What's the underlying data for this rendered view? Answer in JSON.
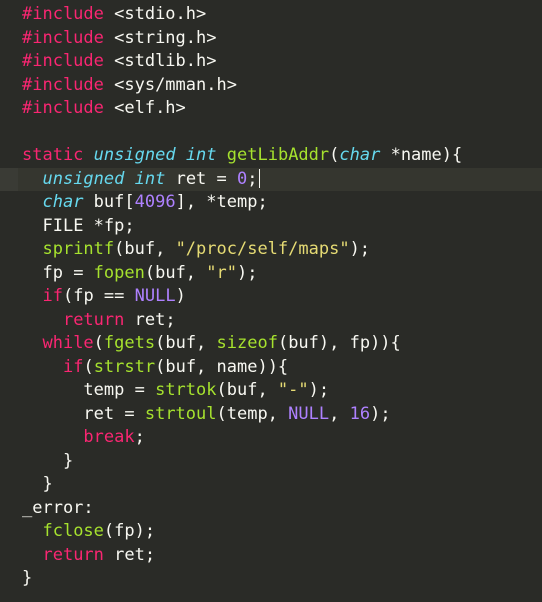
{
  "colors": {
    "background": "#2a2b27",
    "default": "#f8f8f2",
    "keyword": "#f92672",
    "type": "#66d9ef",
    "function": "#a6e22e",
    "string": "#e6db74",
    "number": "#ae81ff",
    "constant": "#ae81ff",
    "punct": "#f8f8f2"
  },
  "lines": [
    {
      "indent": 0,
      "tokens": [
        [
          "keyword",
          "#include"
        ],
        [
          "punct",
          " <stdio.h>"
        ]
      ]
    },
    {
      "indent": 0,
      "tokens": [
        [
          "keyword",
          "#include"
        ],
        [
          "punct",
          " <string.h>"
        ]
      ]
    },
    {
      "indent": 0,
      "tokens": [
        [
          "keyword",
          "#include"
        ],
        [
          "punct",
          " <stdlib.h>"
        ]
      ]
    },
    {
      "indent": 0,
      "tokens": [
        [
          "keyword",
          "#include"
        ],
        [
          "punct",
          " <sys/mman.h>"
        ]
      ]
    },
    {
      "indent": 0,
      "tokens": [
        [
          "keyword",
          "#include"
        ],
        [
          "punct",
          " <elf.h>"
        ]
      ]
    },
    {
      "indent": 0,
      "tokens": []
    },
    {
      "indent": 0,
      "tokens": [
        [
          "keyword",
          "static"
        ],
        [
          "punct",
          " "
        ],
        [
          "type",
          "unsigned"
        ],
        [
          "punct",
          " "
        ],
        [
          "type",
          "int"
        ],
        [
          "punct",
          " "
        ],
        [
          "function",
          "getLibAddr"
        ],
        [
          "punct",
          "("
        ],
        [
          "type",
          "char"
        ],
        [
          "punct",
          " *name){"
        ]
      ]
    },
    {
      "indent": 1,
      "current": true,
      "tokens": [
        [
          "type",
          "unsigned"
        ],
        [
          "punct",
          " "
        ],
        [
          "type",
          "int"
        ],
        [
          "punct",
          " ret = "
        ],
        [
          "number",
          "0"
        ],
        [
          "punct",
          ";"
        ]
      ]
    },
    {
      "indent": 1,
      "tokens": [
        [
          "type",
          "char"
        ],
        [
          "punct",
          " buf["
        ],
        [
          "number",
          "4096"
        ],
        [
          "punct",
          "], *temp;"
        ]
      ]
    },
    {
      "indent": 1,
      "tokens": [
        [
          "punct",
          "FILE *fp;"
        ]
      ]
    },
    {
      "indent": 1,
      "tokens": [
        [
          "function",
          "sprintf"
        ],
        [
          "punct",
          "(buf, "
        ],
        [
          "string",
          "\"/proc/self/maps\""
        ],
        [
          "punct",
          ");"
        ]
      ]
    },
    {
      "indent": 1,
      "tokens": [
        [
          "punct",
          "fp = "
        ],
        [
          "function",
          "fopen"
        ],
        [
          "punct",
          "(buf, "
        ],
        [
          "string",
          "\"r\""
        ],
        [
          "punct",
          ");"
        ]
      ]
    },
    {
      "indent": 1,
      "tokens": [
        [
          "keyword",
          "if"
        ],
        [
          "punct",
          "(fp == "
        ],
        [
          "constant",
          "NULL"
        ],
        [
          "punct",
          ")"
        ]
      ]
    },
    {
      "indent": 2,
      "tokens": [
        [
          "keyword",
          "return"
        ],
        [
          "punct",
          " ret;"
        ]
      ]
    },
    {
      "indent": 1,
      "tokens": [
        [
          "keyword",
          "while"
        ],
        [
          "punct",
          "("
        ],
        [
          "function",
          "fgets"
        ],
        [
          "punct",
          "(buf, "
        ],
        [
          "function",
          "sizeof"
        ],
        [
          "punct",
          "(buf), fp)){"
        ]
      ]
    },
    {
      "indent": 2,
      "tokens": [
        [
          "keyword",
          "if"
        ],
        [
          "punct",
          "("
        ],
        [
          "function",
          "strstr"
        ],
        [
          "punct",
          "(buf, name)){"
        ]
      ]
    },
    {
      "indent": 3,
      "tokens": [
        [
          "punct",
          "temp = "
        ],
        [
          "function",
          "strtok"
        ],
        [
          "punct",
          "(buf, "
        ],
        [
          "string",
          "\"-\""
        ],
        [
          "punct",
          ");"
        ]
      ]
    },
    {
      "indent": 3,
      "tokens": [
        [
          "punct",
          "ret = "
        ],
        [
          "function",
          "strtoul"
        ],
        [
          "punct",
          "(temp, "
        ],
        [
          "constant",
          "NULL"
        ],
        [
          "punct",
          ", "
        ],
        [
          "number",
          "16"
        ],
        [
          "punct",
          ");"
        ]
      ]
    },
    {
      "indent": 3,
      "tokens": [
        [
          "keyword",
          "break"
        ],
        [
          "punct",
          ";"
        ]
      ]
    },
    {
      "indent": 2,
      "tokens": [
        [
          "punct",
          "}"
        ]
      ]
    },
    {
      "indent": 1,
      "tokens": [
        [
          "punct",
          "}"
        ]
      ]
    },
    {
      "indent": 0,
      "tokens": [
        [
          "punct",
          "_error:"
        ]
      ]
    },
    {
      "indent": 1,
      "tokens": [
        [
          "function",
          "fclose"
        ],
        [
          "punct",
          "(fp);"
        ]
      ]
    },
    {
      "indent": 1,
      "tokens": [
        [
          "keyword",
          "return"
        ],
        [
          "punct",
          " ret;"
        ]
      ]
    },
    {
      "indent": 0,
      "tokens": [
        [
          "punct",
          "}"
        ]
      ]
    }
  ]
}
